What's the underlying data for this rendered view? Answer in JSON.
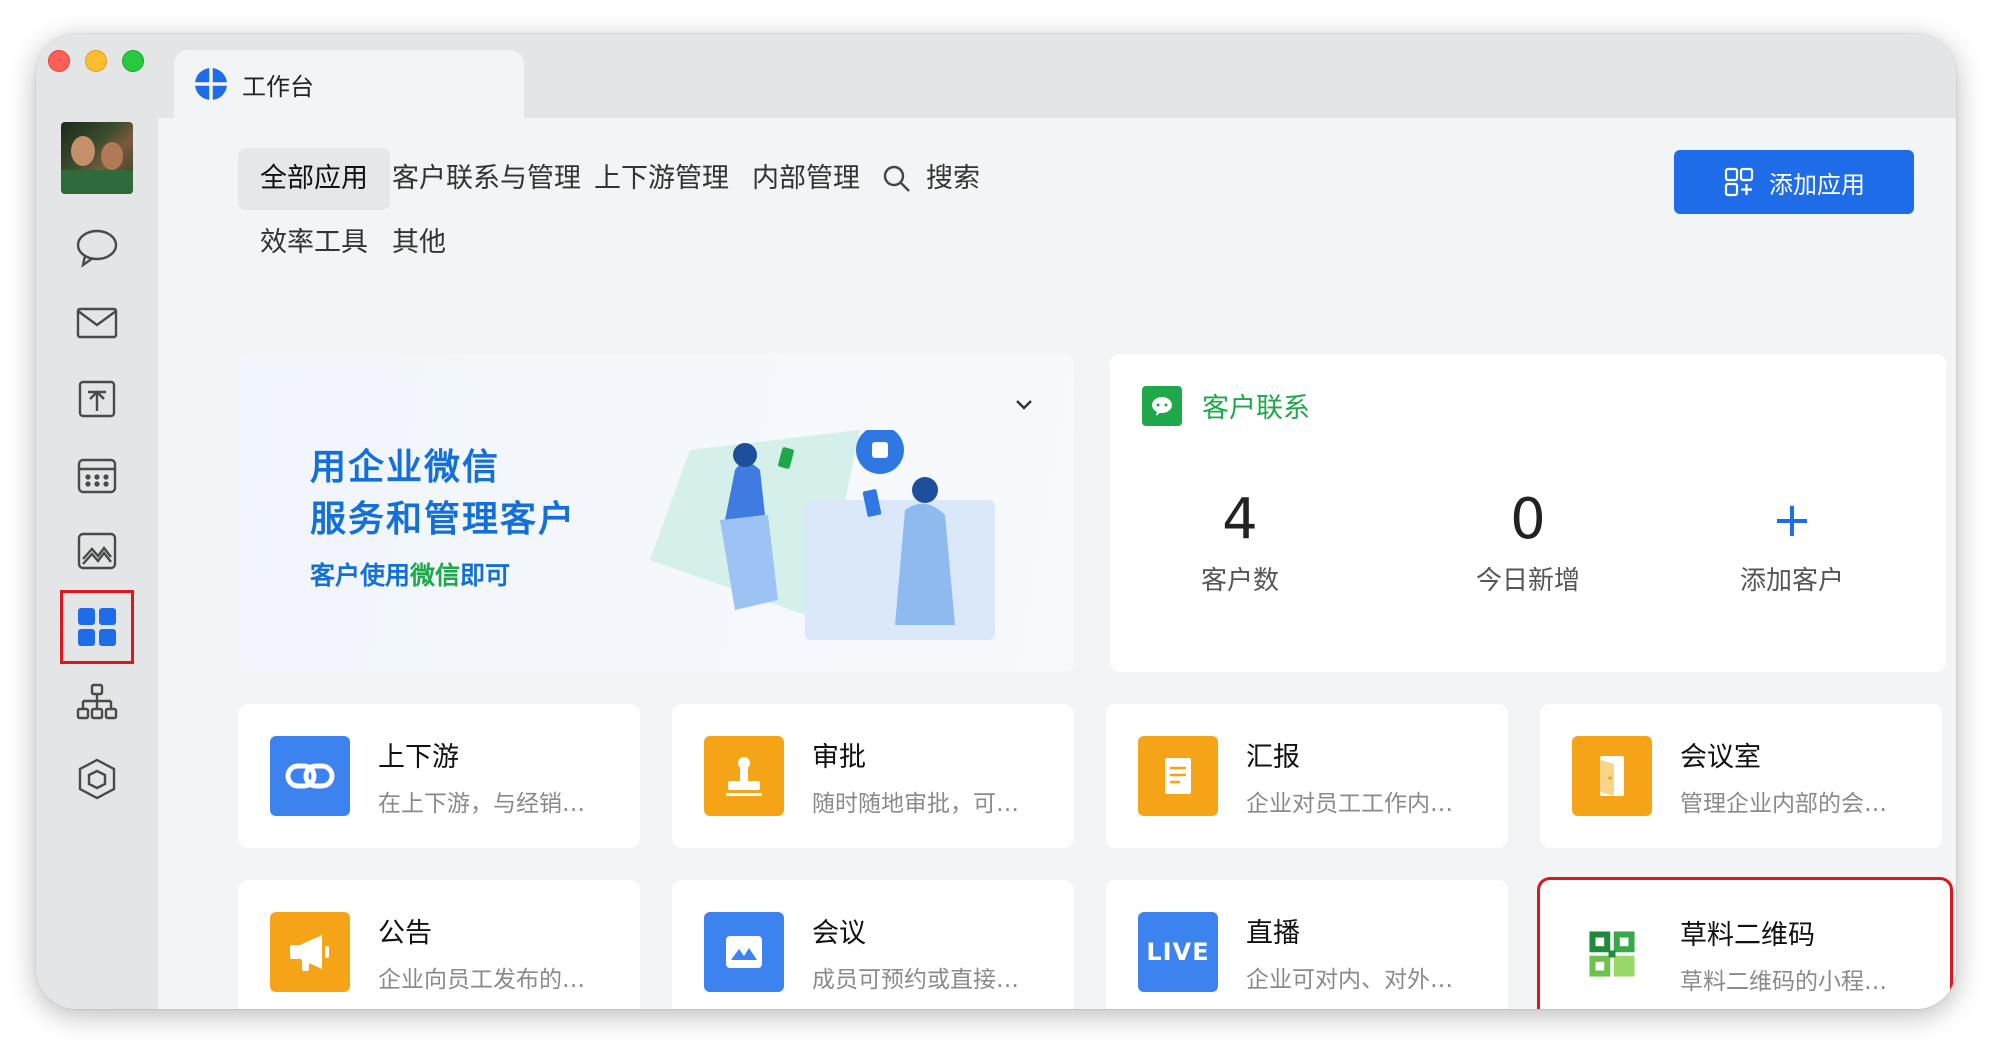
{
  "window": {
    "tab_title": "工作台",
    "controls": [
      "close",
      "minimize",
      "zoom"
    ]
  },
  "sidebar": {
    "items": [
      {
        "name": "avatar"
      },
      {
        "name": "chat-icon"
      },
      {
        "name": "mail-icon"
      },
      {
        "name": "docs-icon"
      },
      {
        "name": "calendar-icon"
      },
      {
        "name": "cloud-drive-icon"
      },
      {
        "name": "workbench-icon",
        "active": true
      },
      {
        "name": "contacts-org-icon"
      },
      {
        "name": "more-apps-icon"
      }
    ]
  },
  "categories": {
    "all": "全部应用",
    "customer": "客户联系与管理",
    "upstream": "上下游管理",
    "internal": "内部管理",
    "search": "搜索",
    "efficiency": "效率工具",
    "other": "其他"
  },
  "toolbar": {
    "add_app": "添加应用"
  },
  "banner": {
    "title_line1": "用企业微信",
    "title_line2": "服务和管理客户",
    "subtitle_prefix": "客户使用",
    "subtitle_highlight": "微信",
    "subtitle_suffix": "即可"
  },
  "customer_panel": {
    "title": "客户联系",
    "stats": [
      {
        "value": "4",
        "label": "客户数"
      },
      {
        "value": "0",
        "label": "今日新增"
      },
      {
        "value": "+",
        "label": "添加客户"
      }
    ]
  },
  "apps": [
    {
      "name": "上下游",
      "desc": "在上下游，与经销…",
      "icon": "link-icon",
      "color": "#3d83f0"
    },
    {
      "name": "审批",
      "desc": "随时随地审批，可…",
      "icon": "stamp-icon",
      "color": "#f6a417"
    },
    {
      "name": "汇报",
      "desc": "企业对员工工作内…",
      "icon": "report-icon",
      "color": "#f6a417"
    },
    {
      "name": "会议室",
      "desc": "管理企业内部的会…",
      "icon": "door-icon",
      "color": "#f6a417"
    },
    {
      "name": "公告",
      "desc": "企业向员工发布的…",
      "icon": "megaphone-icon",
      "color": "#f6a417"
    },
    {
      "name": "会议",
      "desc": "成员可预约或直接…",
      "icon": "meeting-icon",
      "color": "#3d83f0"
    },
    {
      "name": "直播",
      "desc": "企业可对内、对外…",
      "icon": "live-icon",
      "color": "#3d83f0",
      "badge": "LIVE"
    },
    {
      "name": "草料二维码",
      "desc": "草料二维码的小程…",
      "icon": "qrcode-logo-icon",
      "color": "#ffffff"
    }
  ]
}
